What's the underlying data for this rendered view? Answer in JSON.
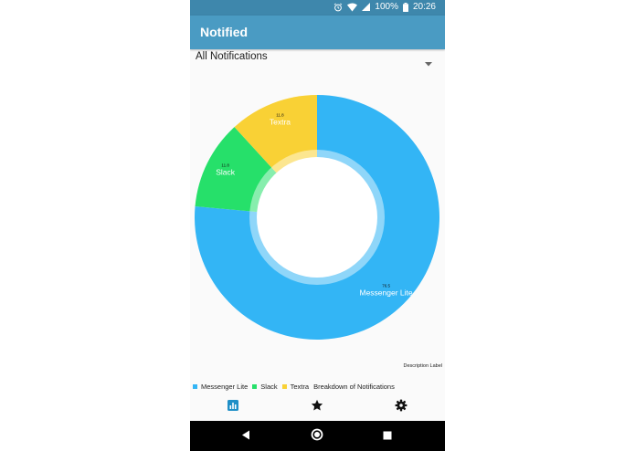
{
  "status_bar": {
    "battery": "100%",
    "time": "20:26"
  },
  "app": {
    "title": "Notified"
  },
  "filter": {
    "selected": "All Notifications"
  },
  "chart_data": {
    "type": "pie",
    "hole": true,
    "categories": [
      "Messenger Lite",
      "Slack",
      "Textra"
    ],
    "values": [
      76.5,
      11.8,
      11.8
    ],
    "value_labels": [
      "76.5",
      "11.8",
      "11.8"
    ],
    "colors": [
      "#33b5f5",
      "#26e06a",
      "#f9d135"
    ],
    "legend_title": "Breakdown of Notifications",
    "description": "Description Label",
    "legend_position": "bottom-left"
  },
  "bottom_nav": [
    {
      "name": "stats",
      "icon": "bar-chart-icon",
      "active": true
    },
    {
      "name": "favorites",
      "icon": "star-icon",
      "active": false
    },
    {
      "name": "settings",
      "icon": "gear-icon",
      "active": false
    }
  ],
  "system_nav": [
    "back-icon",
    "home-icon",
    "recents-icon"
  ],
  "colors": {
    "status_bar": "#3e87ac",
    "app_bar": "#4a9bc3",
    "accent": "#1f8fc7"
  }
}
